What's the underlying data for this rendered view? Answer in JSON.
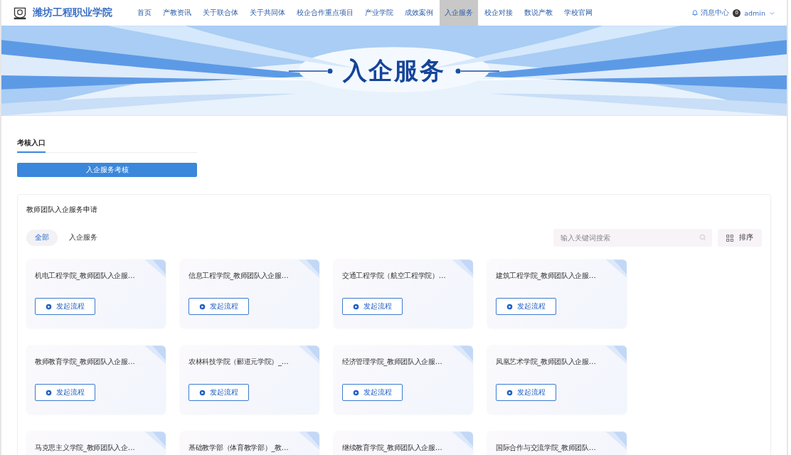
{
  "header": {
    "logo_text": "潍坊工程职业学院",
    "nav": [
      {
        "label": "首页",
        "selected": false
      },
      {
        "label": "产教资讯",
        "selected": false
      },
      {
        "label": "关于联合体",
        "selected": false
      },
      {
        "label": "关于共同体",
        "selected": false
      },
      {
        "label": "校企合作重点项目",
        "selected": false
      },
      {
        "label": "产业学院",
        "selected": false
      },
      {
        "label": "成效案例",
        "selected": false
      },
      {
        "label": "入企服务",
        "selected": true
      },
      {
        "label": "校企对接",
        "selected": false
      },
      {
        "label": "数说产教",
        "selected": false
      },
      {
        "label": "学校官网",
        "selected": false
      }
    ],
    "messages": "消息中心",
    "message_count": "0",
    "user": "admin"
  },
  "banner": {
    "title": "入企服务"
  },
  "review": {
    "tab": "考核入口",
    "button": "入企服务考核"
  },
  "applications": {
    "title": "教师团队入企服务申请",
    "filters": [
      {
        "label": "全部",
        "selected": true
      },
      {
        "label": "入企服务",
        "selected": false
      }
    ],
    "search": {
      "placeholder": "输入关键词搜索"
    },
    "sort_button": "排序",
    "cards": [
      {
        "title": "机电工程学院_教师团队入企服…",
        "button": "发起流程"
      },
      {
        "title": "信息工程学院_教师团队入企服…",
        "button": "发起流程"
      },
      {
        "title": "交通工程学院（航空工程学院）…",
        "button": "发起流程"
      },
      {
        "title": "建筑工程学院_教师团队入企服…",
        "button": "发起流程"
      },
      {
        "title": "教师教育学院_教师团队入企服…",
        "button": "发起流程"
      },
      {
        "title": "农林科技学院（郦道元学院）_…",
        "button": "发起流程"
      },
      {
        "title": "经济管理学院_教师团队入企服…",
        "button": "发起流程"
      },
      {
        "title": "凤凰艺术学院_教师团队入企服…",
        "button": "发起流程"
      },
      {
        "title": "马克思主义学院_教师团队入企…"
      },
      {
        "title": "基础教学部（体育教学部）_教…"
      },
      {
        "title": "继续教育学院_教师团队入企服…"
      },
      {
        "title": "国际合作与交流学院_教师团队…"
      }
    ]
  }
}
